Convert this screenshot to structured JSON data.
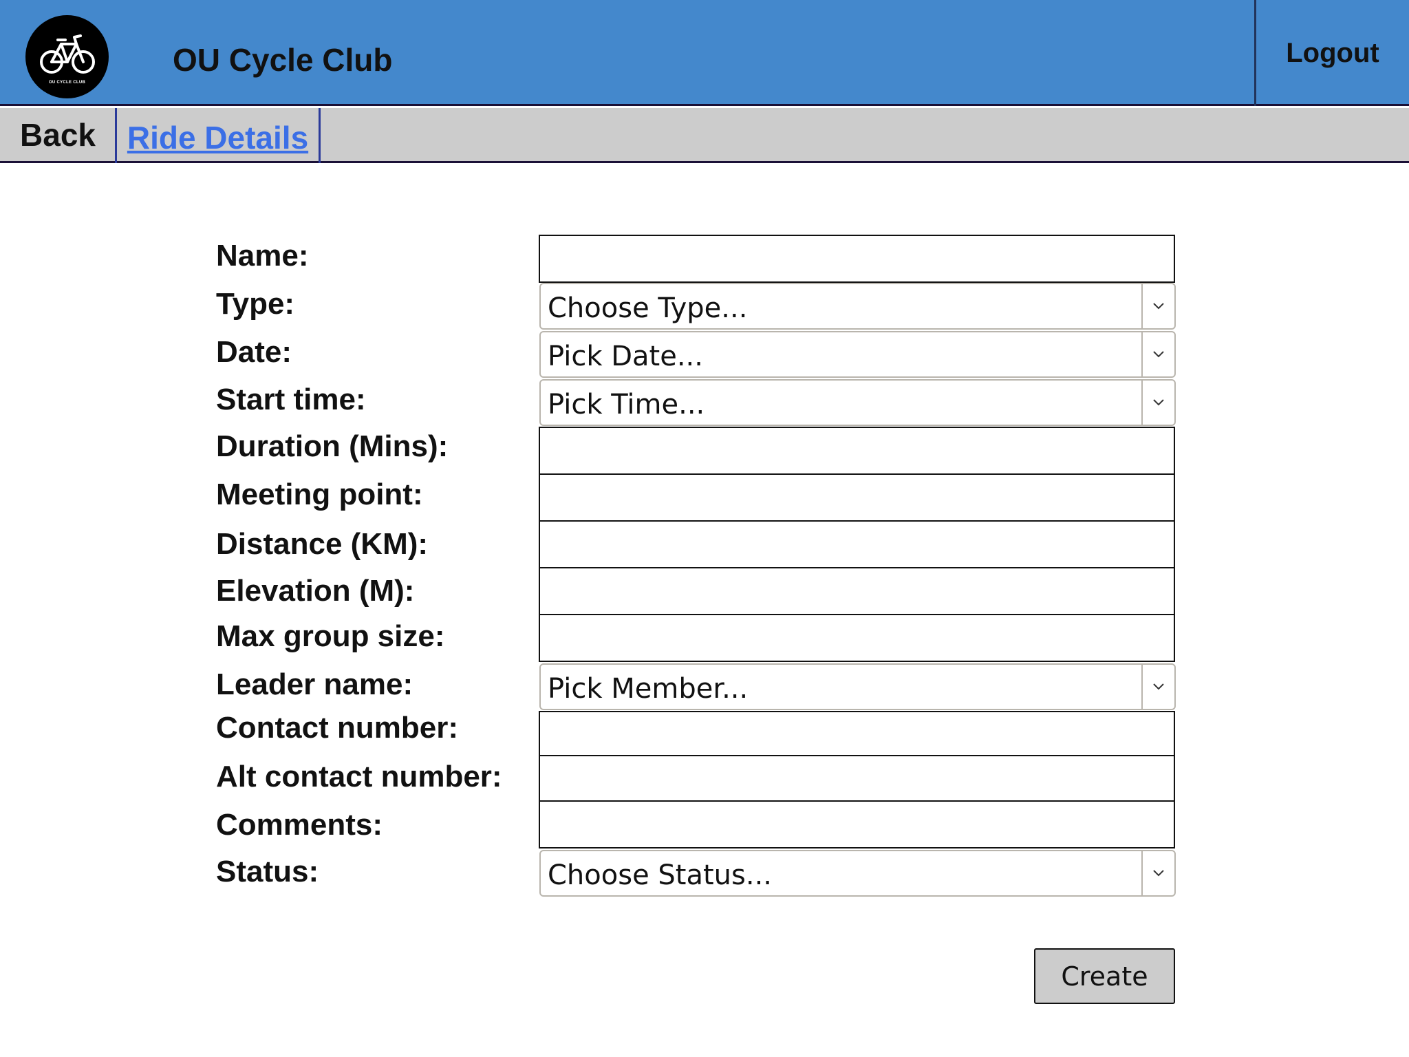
{
  "header": {
    "logo_text": "OU CYCLE CLUB",
    "title": "OU Cycle Club",
    "logout_label": "Logout"
  },
  "nav": {
    "back_label": "Back",
    "tab_label": "Ride Details"
  },
  "form": {
    "name_label": "Name:",
    "type_label": "Type:",
    "type_value": "Choose Type...",
    "date_label": "Date:",
    "date_value": "Pick Date...",
    "start_time_label": "Start time:",
    "start_time_value": "Pick Time...",
    "duration_label": "Duration (Mins):",
    "meeting_point_label": "Meeting point:",
    "distance_label": "Distance (KM):",
    "elevation_label": "Elevation (M):",
    "max_group_label": "Max group size:",
    "leader_label": "Leader name:",
    "leader_value": "Pick Member...",
    "contact_label": "Contact number:",
    "alt_contact_label": "Alt contact number:",
    "comments_label": "Comments:",
    "status_label": "Status:",
    "status_value": "Choose Status...",
    "create_label": "Create"
  },
  "colors": {
    "header_bg": "#4488cc",
    "nav_bg": "#cccccc",
    "link": "#3b6fe6",
    "button_bg": "#cccccc"
  },
  "icons": {
    "logo": "bicycle-icon",
    "dropdown": "chevron-down-icon"
  }
}
